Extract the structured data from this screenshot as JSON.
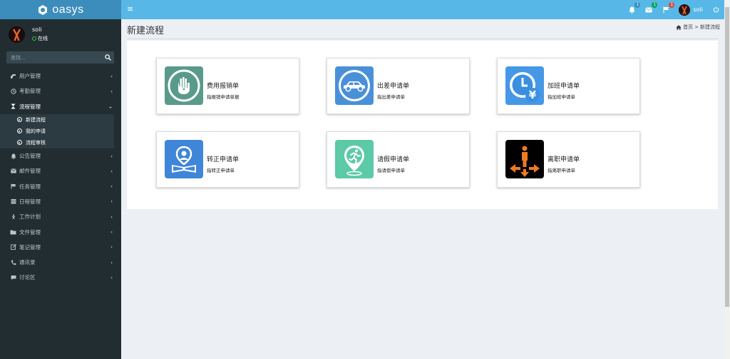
{
  "app": {
    "logo_text": "oasys"
  },
  "navbar": {
    "notifications": [
      {
        "icon": "bell-icon",
        "count": "1",
        "color": "#3c8dbc"
      },
      {
        "icon": "mail-icon",
        "count": "1",
        "color": "#00a65a"
      },
      {
        "icon": "flag-icon",
        "count": "1",
        "color": "#dd4b39"
      }
    ],
    "user_name": "soli"
  },
  "sidebar": {
    "user_name": "soli",
    "status": "在线",
    "search_placeholder": "查找...",
    "menu": [
      {
        "label": "用户管理",
        "icon": "user-icon"
      },
      {
        "label": "考勤管理",
        "icon": "clock-icon"
      },
      {
        "label": "流程管理",
        "icon": "hourglass-icon",
        "open": true,
        "children": [
          "新建流程",
          "我的申请",
          "流程审核"
        ]
      },
      {
        "label": "公告管理",
        "icon": "bell-icon"
      },
      {
        "label": "邮件管理",
        "icon": "mail-icon"
      },
      {
        "label": "任务管理",
        "icon": "flag-icon"
      },
      {
        "label": "日程管理",
        "icon": "calendar-icon"
      },
      {
        "label": "工作计划",
        "icon": "plan-icon"
      },
      {
        "label": "文件管理",
        "icon": "folder-icon"
      },
      {
        "label": "笔记管理",
        "icon": "note-icon"
      },
      {
        "label": "通讯录",
        "icon": "phone-icon"
      },
      {
        "label": "讨论区",
        "icon": "comment-icon"
      }
    ]
  },
  "header": {
    "title": "新建流程",
    "breadcrumb_home": "首页",
    "breadcrumb_sep": ">",
    "breadcrumb_current": "新建流程"
  },
  "cards": [
    {
      "title": "费用报销单",
      "desc": "指报销申请单据",
      "icon": "expense-icon",
      "color": "#5a9a8c"
    },
    {
      "title": "出差申请单",
      "desc": "指出差申请单",
      "icon": "car-icon",
      "color": "#4a90d9"
    },
    {
      "title": "加班申请单",
      "desc": "指加班申请单",
      "icon": "overtime-clock-icon",
      "color": "#3b8fe0"
    },
    {
      "title": "转正申请单",
      "desc": "指转正申请单",
      "icon": "regular-icon",
      "color": "#3f86d8"
    },
    {
      "title": "请假申请单",
      "desc": "指请假申请单",
      "icon": "leave-icon",
      "color": "#5cc9a7"
    },
    {
      "title": "离职申请单",
      "desc": "指离职申请单",
      "icon": "resign-icon",
      "color": "#000000"
    }
  ]
}
